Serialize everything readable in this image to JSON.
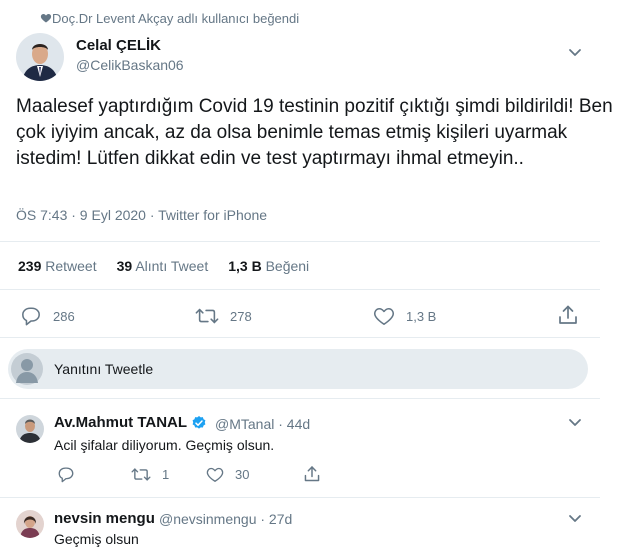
{
  "social_context": "Doç.Dr Levent Akçay adlı kullanıcı beğendi",
  "tweet": {
    "author_name": "Celal ÇELİK",
    "author_handle": "@CelikBaskan06",
    "text": "Maalesef yaptırdığım Covid 19 testinin pozitif çıktığı şimdi bildirildi! Ben çok iyiyim ancak, az da olsa benimle temas etmiş kişileri uyarmak istedim! Lütfen dikkat edin ve test yaptırmayı ihmal etmeyin..",
    "meta": "ÖS 7:43 · 9 Eyl 2020 · Twitter for iPhone",
    "stats": {
      "retweet_count": "239",
      "retweet_label": "Retweet",
      "quote_count": "39",
      "quote_label": "Alıntı Tweet",
      "like_count": "1,3 B",
      "like_label": "Beğeni"
    },
    "actions": {
      "reply_count": "286",
      "retweet_count": "278",
      "like_count": "1,3 B"
    }
  },
  "reply_box": {
    "placeholder": "Yanıtını Tweetle"
  },
  "replies": [
    {
      "name": "Av.Mahmut TANAL",
      "verified": true,
      "handle": "@MTanal · 44d",
      "text": "Acil şifalar diliyorum. Geçmiş olsun.",
      "retweet_count": "1",
      "like_count": "30"
    },
    {
      "name": "nevsin mengu",
      "verified": false,
      "handle": "@nevsinmengu · 27d",
      "text": "Geçmiş olsun"
    }
  ],
  "colors": {
    "accent": "#1da1f2",
    "muted": "#657786",
    "divider": "#e6ecf0",
    "text": "#14171a"
  },
  "icons": [
    "heart-icon",
    "chevron-down-icon",
    "reply-icon",
    "retweet-icon",
    "like-icon",
    "share-icon",
    "verified-icon"
  ]
}
